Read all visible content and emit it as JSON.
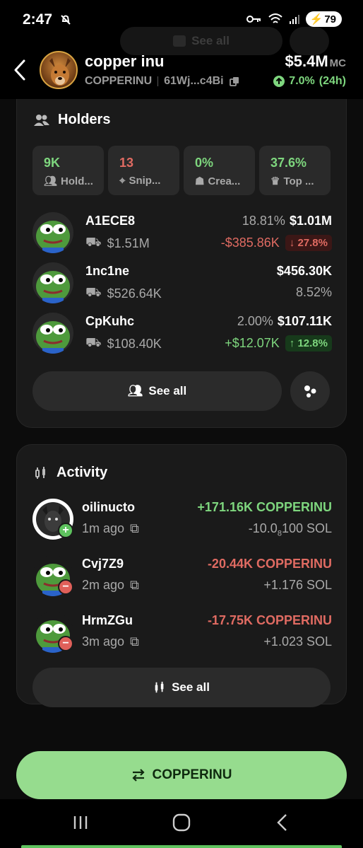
{
  "status_bar": {
    "time": "2:47",
    "battery": "79"
  },
  "header": {
    "ghost_see_all": "See all",
    "token_name": "copper inu",
    "token_symbol": "COPPERINU",
    "address": "61Wj...c4Bi",
    "market_cap": "$5.4M",
    "market_cap_unit": "MC",
    "change": "7.0%",
    "change_period": "(24h)"
  },
  "holders": {
    "title": "Holders",
    "stats": [
      {
        "value": "9K",
        "label": "Hold...",
        "icon": "users-icon",
        "color": "#7ed67e"
      },
      {
        "value": "13",
        "label": "Snip...",
        "icon": "crosshair-icon",
        "color": "#e06b62"
      },
      {
        "value": "0%",
        "label": "Crea...",
        "icon": "chef-hat-icon",
        "color": "#7ed67e"
      },
      {
        "value": "37.6%",
        "label": "Top ...",
        "icon": "crown-icon",
        "color": "#7ed67e"
      }
    ],
    "rows": [
      {
        "name": "A1ECE8",
        "balance": "$1.51M",
        "pct": "18.81%",
        "value": "$1.01M",
        "pnl": "-$385.86K",
        "pnl_pct": "27.8%",
        "dir": "down"
      },
      {
        "name": "1nc1ne",
        "balance": "$526.64K",
        "pct": "8.52%",
        "value": "$456.30K",
        "pnl": "",
        "pnl_pct": "",
        "dir": ""
      },
      {
        "name": "CpKuhc",
        "balance": "$108.40K",
        "pct": "2.00%",
        "value": "$107.11K",
        "pnl": "+$12.07K",
        "pnl_pct": "12.8%",
        "dir": "up"
      }
    ],
    "see_all": "See all"
  },
  "activity": {
    "title": "Activity",
    "rows": [
      {
        "name": "oilinucto",
        "time": "1m ago",
        "amount": "+171.16K COPPERINU",
        "sol_main": "-10.0",
        "sol_sub": "8",
        "sol_rest": "100 SOL",
        "type": "buy"
      },
      {
        "name": "Cvj7Z9",
        "time": "2m ago",
        "amount": "-20.44K COPPERINU",
        "sol": "+1.176 SOL",
        "type": "sell"
      },
      {
        "name": "HrmZGu",
        "time": "3m ago",
        "amount": "-17.75K COPPERINU",
        "sol": "+1.023 SOL",
        "type": "sell"
      }
    ],
    "see_all": "See all"
  },
  "cta": {
    "label": "COPPERINU"
  },
  "colors": {
    "accent": "#96dc8e",
    "positive": "#7ed67e",
    "negative": "#e06b62",
    "card": "#1a1a1a"
  }
}
